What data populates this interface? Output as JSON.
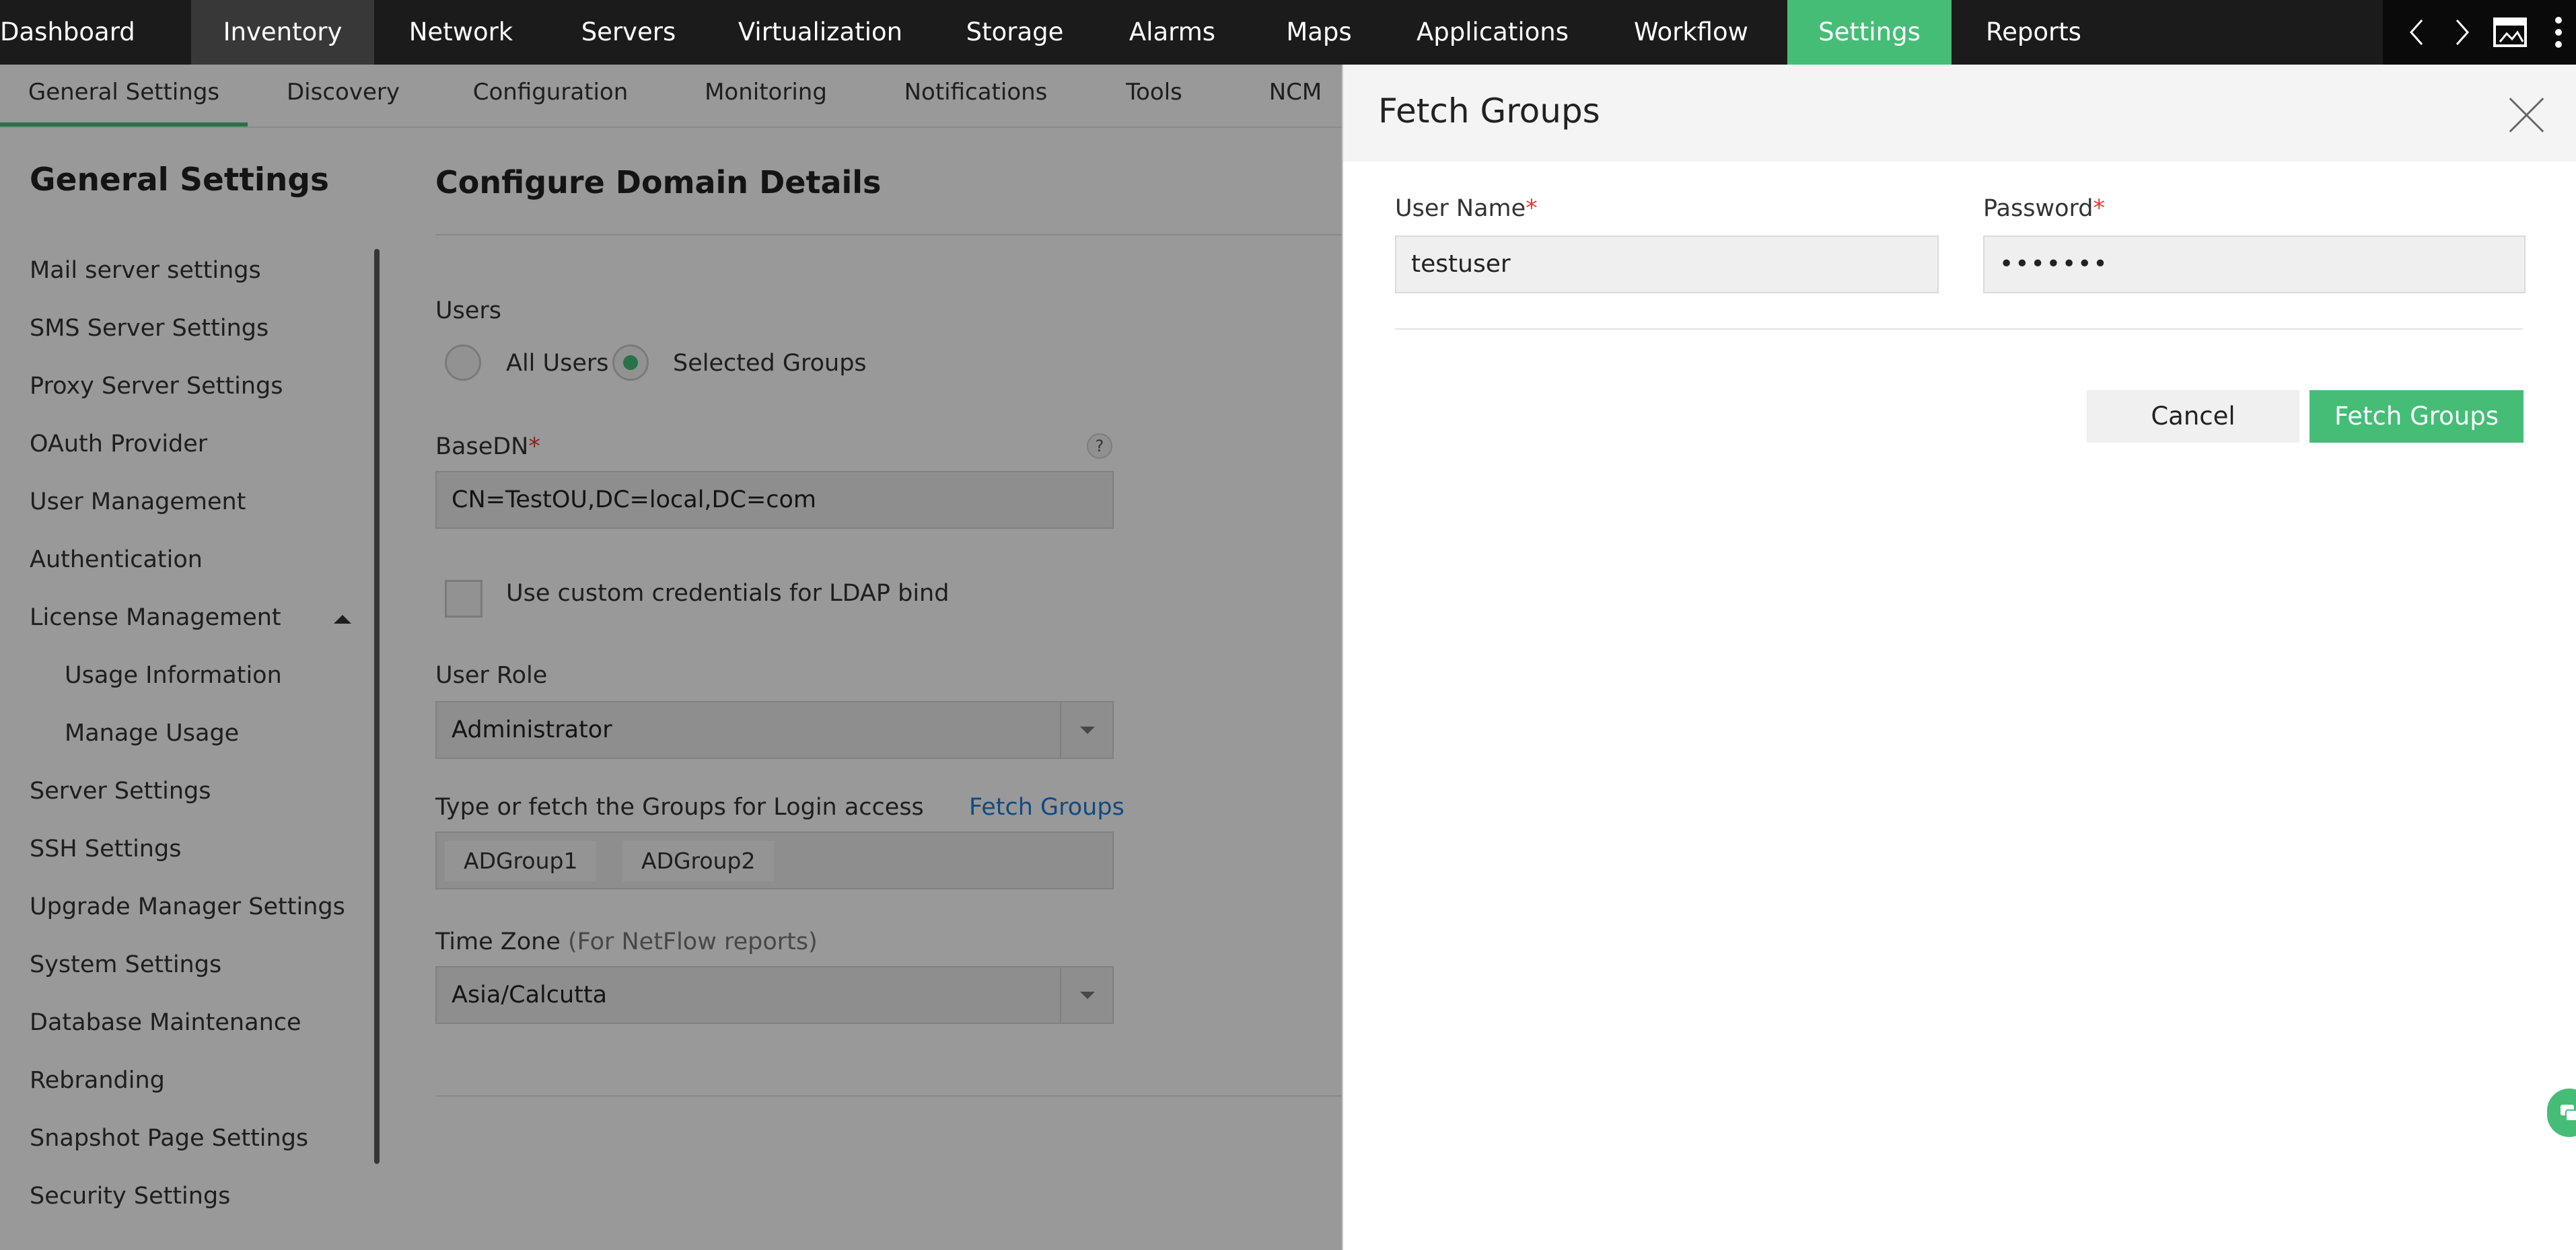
{
  "topnav": {
    "items": [
      "Dashboard",
      "Inventory",
      "Network",
      "Servers",
      "Virtualization",
      "Storage",
      "Alarms",
      "Maps",
      "Applications",
      "Workflow",
      "Settings",
      "Reports"
    ],
    "active": "Settings",
    "tools": [
      "chevron-left-icon",
      "chevron-right-icon",
      "screen-icon",
      "more-vertical-icon"
    ]
  },
  "subnav": {
    "items": [
      "General Settings",
      "Discovery",
      "Configuration",
      "Monitoring",
      "Notifications",
      "Tools",
      "NCM"
    ],
    "active": "General Settings"
  },
  "sidebar": {
    "title": "General Settings",
    "links": [
      "Mail server settings",
      "SMS Server Settings",
      "Proxy Server Settings",
      "OAuth Provider",
      "User Management",
      "Authentication",
      "License Management",
      "Usage Information",
      "Manage Usage",
      "Server Settings",
      "SSH Settings",
      "Upgrade Manager Settings",
      "System Settings",
      "Database Maintenance",
      "Rebranding",
      "Snapshot Page Settings",
      "Security Settings"
    ]
  },
  "form": {
    "title": "Configure Domain Details",
    "users_label": "Users",
    "radio_all": "All Users",
    "radio_selected": "Selected Groups",
    "basedn_label": "BaseDN",
    "basedn_value": "CN=TestOU,DC=local,DC=com",
    "help": "?",
    "ldap_checkbox": "Use custom credentials for LDAP bind",
    "role_label": "User Role",
    "role_value": "Administrator",
    "groups_label": "Type or fetch the Groups for Login access",
    "fetch_link": "Fetch Groups",
    "groups": [
      "ADGroup1",
      "ADGroup2"
    ],
    "tz_label": "Time Zone",
    "tz_note": "(For NetFlow reports)",
    "tz_value": "Asia/Calcutta",
    "required_mark": "*"
  },
  "panel": {
    "title": "Fetch Groups",
    "username_label": "User Name",
    "username_value": "testuser",
    "password_label": "Password",
    "password_value": "•••••••",
    "cancel": "Cancel",
    "submit": "Fetch Groups"
  },
  "colors": {
    "accent": "#45bd77",
    "link": "#1c7cd6",
    "required": "#e53935",
    "topbar": "#1b1b1b"
  }
}
